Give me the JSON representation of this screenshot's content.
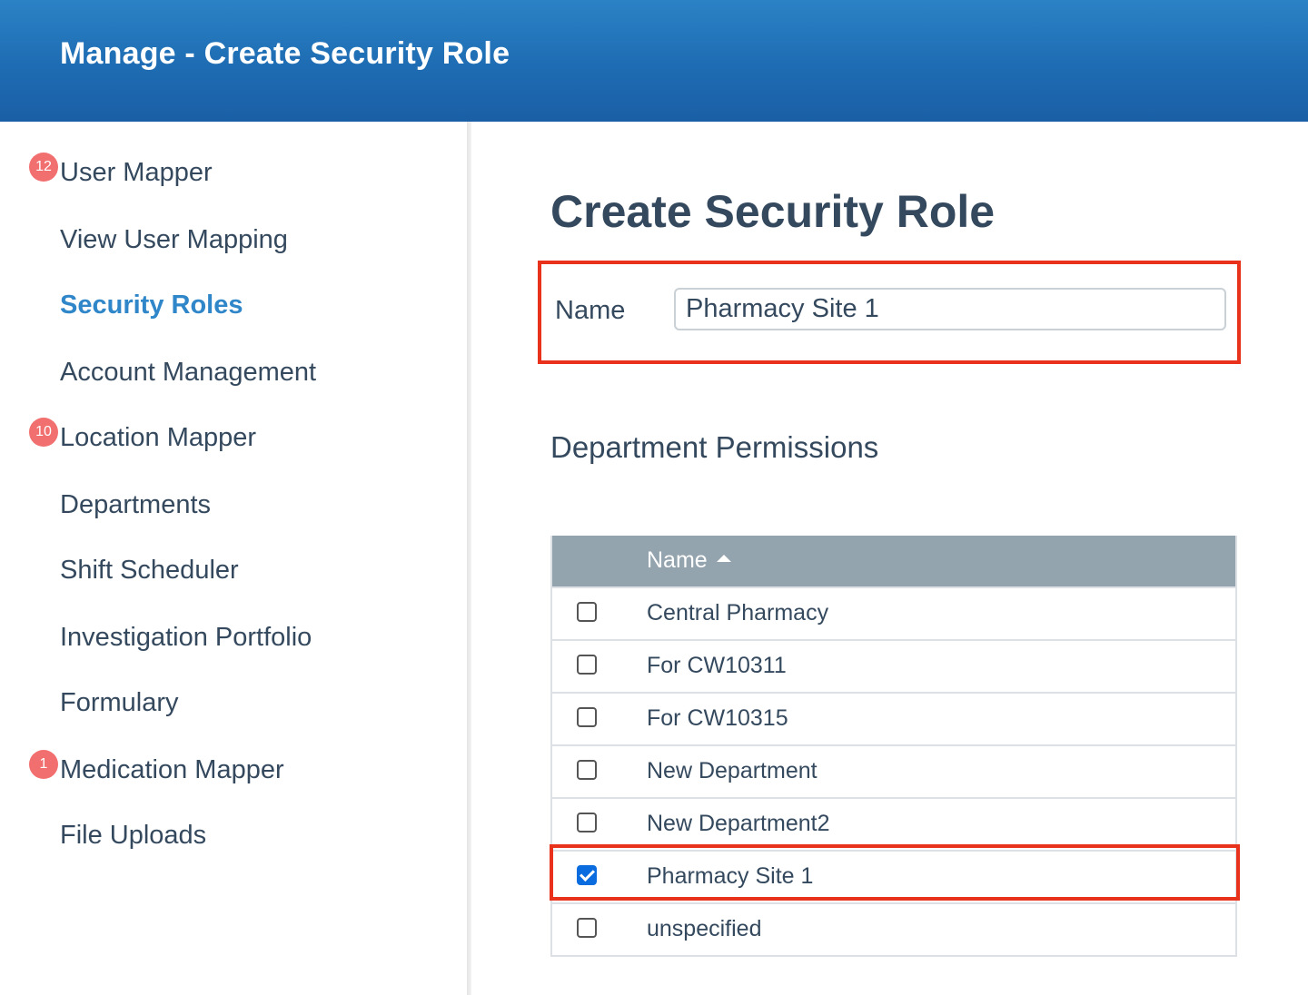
{
  "header": {
    "title": "Manage - Create Security Role"
  },
  "sidebar": {
    "items": [
      {
        "label": "User Mapper",
        "badge": "12"
      },
      {
        "label": "View User Mapping"
      },
      {
        "label": "Security Roles",
        "active": true
      },
      {
        "label": "Account Management"
      },
      {
        "label": "Location Mapper",
        "badge": "10"
      },
      {
        "label": "Departments"
      },
      {
        "label": "Shift Scheduler"
      },
      {
        "label": "Investigation Portfolio"
      },
      {
        "label": "Formulary"
      },
      {
        "label": "Medication Mapper",
        "badge": "1"
      },
      {
        "label": "File Uploads"
      }
    ]
  },
  "main": {
    "title": "Create Security Role",
    "name_label": "Name",
    "name_value": "Pharmacy Site 1",
    "section_title": "Department Permissions",
    "table": {
      "column_header": "Name",
      "sort": "ascending",
      "rows": [
        {
          "name": "Central Pharmacy",
          "checked": false
        },
        {
          "name": "For CW10311",
          "checked": false
        },
        {
          "name": "For CW10315",
          "checked": false
        },
        {
          "name": "New Department",
          "checked": false
        },
        {
          "name": "New Department2",
          "checked": false
        },
        {
          "name": "Pharmacy Site 1",
          "checked": true
        },
        {
          "name": "unspecified",
          "checked": false
        }
      ]
    }
  },
  "colors": {
    "header_bg": "#1e6cb3",
    "active_nav": "#2f86c8",
    "badge": "#f26f6f",
    "highlight": "#e8321c",
    "table_header": "#94a4ae",
    "checkbox_checked": "#0a6cdf"
  }
}
